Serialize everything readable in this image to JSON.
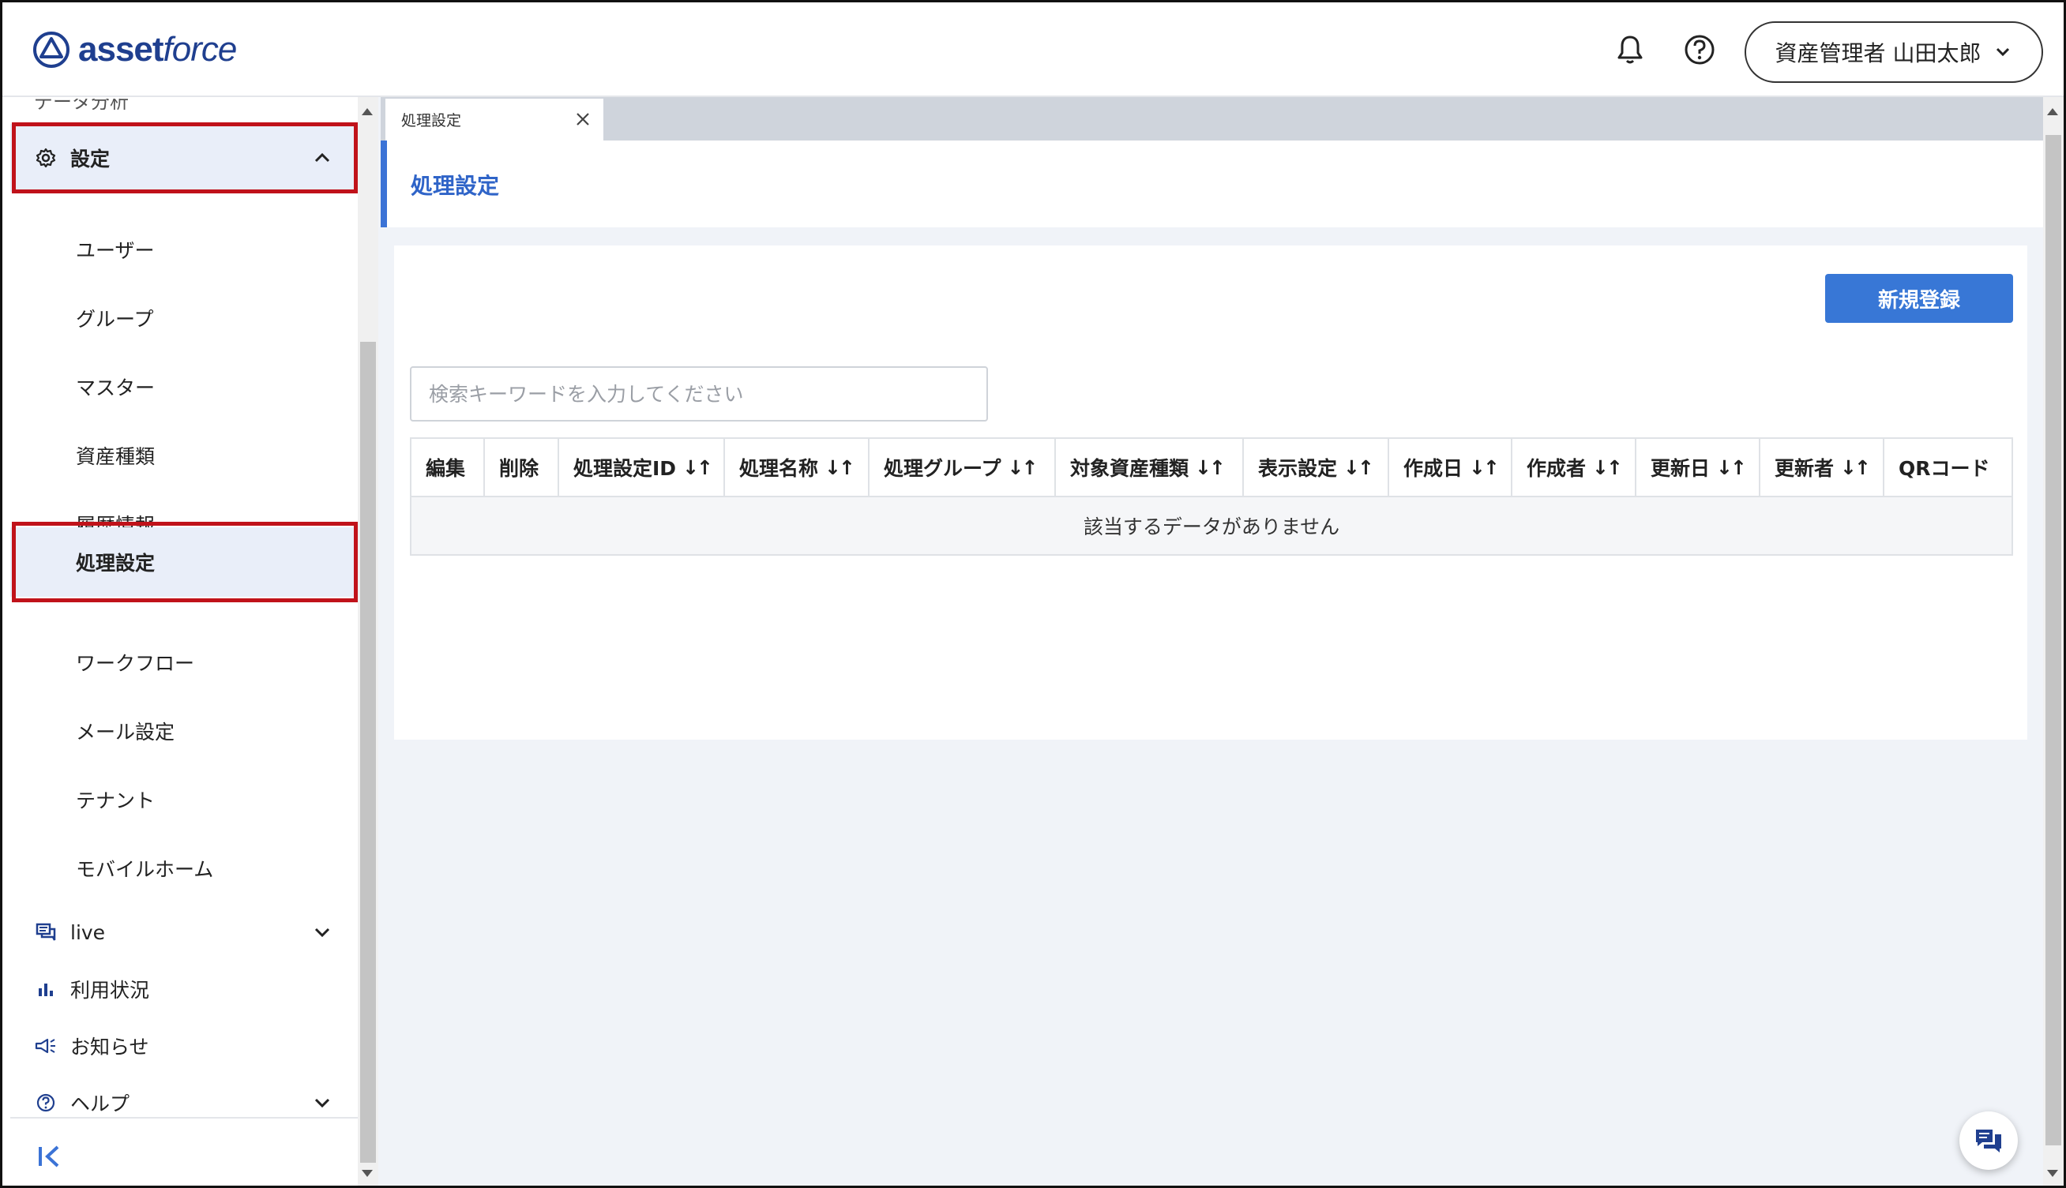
{
  "header": {
    "logo_text_1": "asset",
    "logo_text_2": "force",
    "user_label": "資産管理者 山田太郎"
  },
  "sidebar": {
    "cut_item_label": "データ分析",
    "settings": {
      "label": "設定",
      "expanded": true,
      "sub_items": [
        {
          "label": "ユーザー"
        },
        {
          "label": "グループ"
        },
        {
          "label": "マスター"
        },
        {
          "label": "資産種類"
        },
        {
          "label": "履歴情報"
        },
        {
          "label": "処理設定",
          "active": true
        },
        {
          "label": "ワークフロー"
        },
        {
          "label": "メール設定"
        },
        {
          "label": "テナント"
        },
        {
          "label": "モバイルホーム"
        }
      ]
    },
    "items": [
      {
        "label": "live",
        "icon": "chat-icon",
        "has_chevron": true
      },
      {
        "label": "利用状況",
        "icon": "bar-chart-icon",
        "has_chevron": false
      },
      {
        "label": "お知らせ",
        "icon": "megaphone-icon",
        "has_chevron": false
      },
      {
        "label": "ヘルプ",
        "icon": "help-circle-icon",
        "has_chevron": true
      }
    ]
  },
  "tabs": [
    {
      "label": "処理設定",
      "active": true
    }
  ],
  "page": {
    "title": "処理設定",
    "new_button": "新規登録",
    "search_placeholder": "検索キーワードを入力してください",
    "table": {
      "columns": [
        {
          "label": "編集",
          "sortable": false
        },
        {
          "label": "削除",
          "sortable": false
        },
        {
          "label": "処理設定ID",
          "sortable": true
        },
        {
          "label": "処理名称",
          "sortable": true
        },
        {
          "label": "処理グループ",
          "sortable": true
        },
        {
          "label": "対象資産種類",
          "sortable": true
        },
        {
          "label": "表示設定",
          "sortable": true
        },
        {
          "label": "作成日",
          "sortable": true
        },
        {
          "label": "作成者",
          "sortable": true
        },
        {
          "label": "更新日",
          "sortable": true
        },
        {
          "label": "更新者",
          "sortable": true
        },
        {
          "label": "QRコード",
          "sortable": false
        }
      ],
      "empty_message": "該当するデータがありません"
    }
  },
  "colors": {
    "accent": "#3877d6",
    "title": "#2f64c8",
    "highlight_border": "#c0121a",
    "active_bg": "#e9eef9"
  }
}
